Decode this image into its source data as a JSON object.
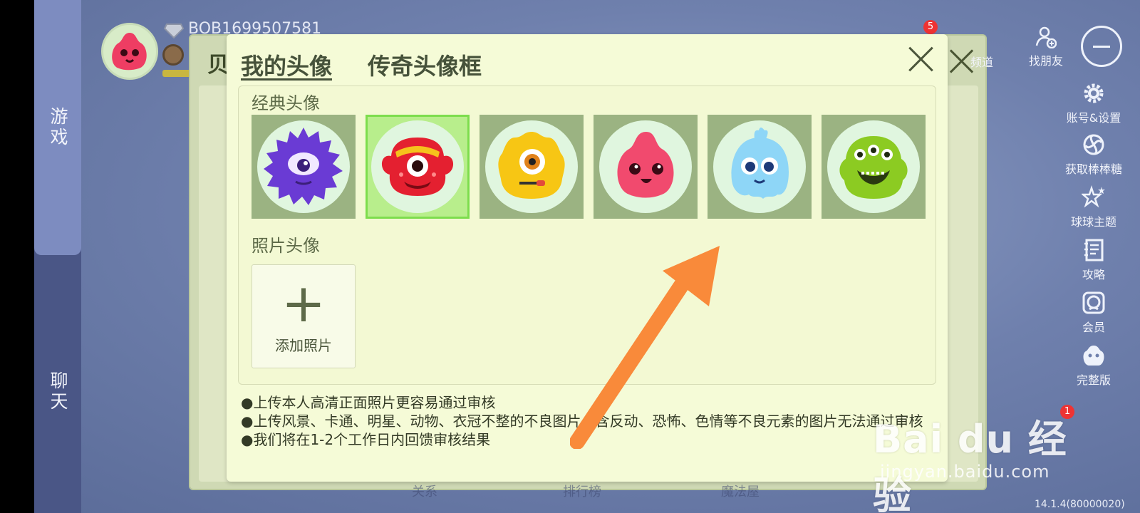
{
  "left_nav": {
    "game_tab": "游戏",
    "chat_tab": "聊天"
  },
  "user": {
    "id_label": "BOB1699507581"
  },
  "top_right": {
    "friend_label": "找朋友",
    "channel_label": "频道",
    "badge_count": "5"
  },
  "right_menu": [
    {
      "label": "账号&设置",
      "icon": "gear-icon"
    },
    {
      "label": "获取棒棒糖",
      "icon": "lollipop-icon"
    },
    {
      "label": "球球主题",
      "icon": "theme-stars-icon"
    },
    {
      "label": "攻略",
      "icon": "guide-book-icon"
    },
    {
      "label": "会员",
      "icon": "member-icon"
    },
    {
      "label": "完整版",
      "icon": "full-version-icon"
    }
  ],
  "back_panel": {
    "title": "贝"
  },
  "bottom_tabs": [
    "关系",
    "排行榜",
    "魔法屋"
  ],
  "gift_badge": "1",
  "version": "14.1.4(80000020)",
  "modal": {
    "tabs": {
      "my_avatar": "我的头像",
      "legend_frame": "传奇头像框"
    },
    "classic_section_title": "经典头像",
    "photo_section_title": "照片头像",
    "add_photo_label": "添加照片",
    "avatars": [
      {
        "name": "purple-spiky",
        "color": "#6b3fd6"
      },
      {
        "name": "red-cyclops",
        "color": "#e2222e"
      },
      {
        "name": "yellow-fuzzy",
        "color": "#f6c61a"
      },
      {
        "name": "pink-blob",
        "color": "#f04a6e"
      },
      {
        "name": "blue-ghost",
        "color": "#8fd6f6"
      },
      {
        "name": "green-three-eyed",
        "color": "#8cc824"
      }
    ],
    "selected_index": 1,
    "notes": [
      "●上传本人高清正面照片更容易通过审核",
      "●上传风景、卡通、明星、动物、衣冠不整的不良图片、含反动、恐怖、色情等不良元素的图片无法通过审核",
      "●我们将在1-2个工作日内回馈审核结果"
    ]
  },
  "watermark": {
    "main": "Bai du 经验",
    "sub": "jingyan.baidu.com"
  },
  "colors": {
    "modal_bg": "#f5fbd7",
    "selected_border": "#7ddd4d",
    "arrow": "#f98a3a"
  }
}
